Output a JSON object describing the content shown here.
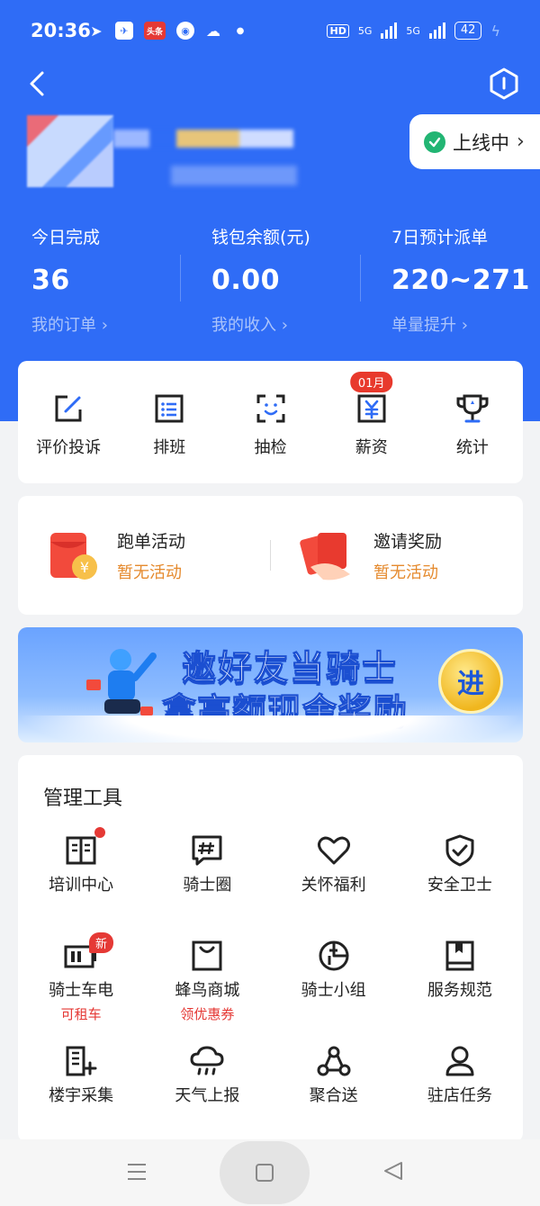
{
  "status_bar": {
    "time": "20:36",
    "app_icons": [
      "location-arrow-icon",
      "app-icon",
      "toutiao-icon",
      "app-circle-icon",
      "wechat-icon",
      "dot-icon"
    ],
    "toutiao_label": "头条",
    "hd_label": "HD",
    "net1": "5G",
    "net2": "5G",
    "battery": "42"
  },
  "header": {
    "status_label": "上线中"
  },
  "stats": [
    {
      "label": "今日完成",
      "value": "36",
      "link": "我的订单 ›"
    },
    {
      "label": "钱包余额(元)",
      "value": "0.00",
      "link": "我的收入 ›"
    },
    {
      "label": "7日预计派单",
      "value": "220~271",
      "link": "单量提升 ›"
    }
  ],
  "quick_actions": [
    {
      "label": "评价投诉",
      "icon": "edit-icon"
    },
    {
      "label": "排班",
      "icon": "schedule-icon"
    },
    {
      "label": "抽检",
      "icon": "face-scan-icon"
    },
    {
      "label": "薪资",
      "icon": "salary-icon",
      "badge": "01月"
    },
    {
      "label": "统计",
      "icon": "trophy-icon"
    }
  ],
  "activities": [
    {
      "title": "跑单活动",
      "status": "暂无活动"
    },
    {
      "title": "邀请奖励",
      "status": "暂无活动"
    }
  ],
  "banner": {
    "line1": "邀好友当骑士",
    "line2": "拿高额现金奖励",
    "button": "进"
  },
  "tools": {
    "title": "管理工具",
    "items": [
      {
        "label": "培训中心",
        "icon": "book-icon",
        "dot": true
      },
      {
        "label": "骑士圈",
        "icon": "chat-hash-icon"
      },
      {
        "label": "关怀福利",
        "icon": "heart-icon"
      },
      {
        "label": "安全卫士",
        "icon": "shield-icon"
      },
      {
        "label": "骑士车电",
        "icon": "battery-icon",
        "badge": "新",
        "sub": "可租车"
      },
      {
        "label": "蜂鸟商城",
        "icon": "shopping-bag-icon",
        "sub": "领优惠券"
      },
      {
        "label": "骑士小组",
        "icon": "group-icon"
      },
      {
        "label": "服务规范",
        "icon": "guide-book-icon"
      },
      {
        "label": "楼宇采集",
        "icon": "building-add-icon"
      },
      {
        "label": "天气上报",
        "icon": "cloud-rain-icon"
      },
      {
        "label": "聚合送",
        "icon": "network-icon"
      },
      {
        "label": "驻店任务",
        "icon": "person-icon"
      }
    ]
  },
  "colors": {
    "primary": "#2f6cf6",
    "online_green": "#22b573",
    "badge_red": "#e8392c",
    "activity_orange": "#e58a2e"
  }
}
